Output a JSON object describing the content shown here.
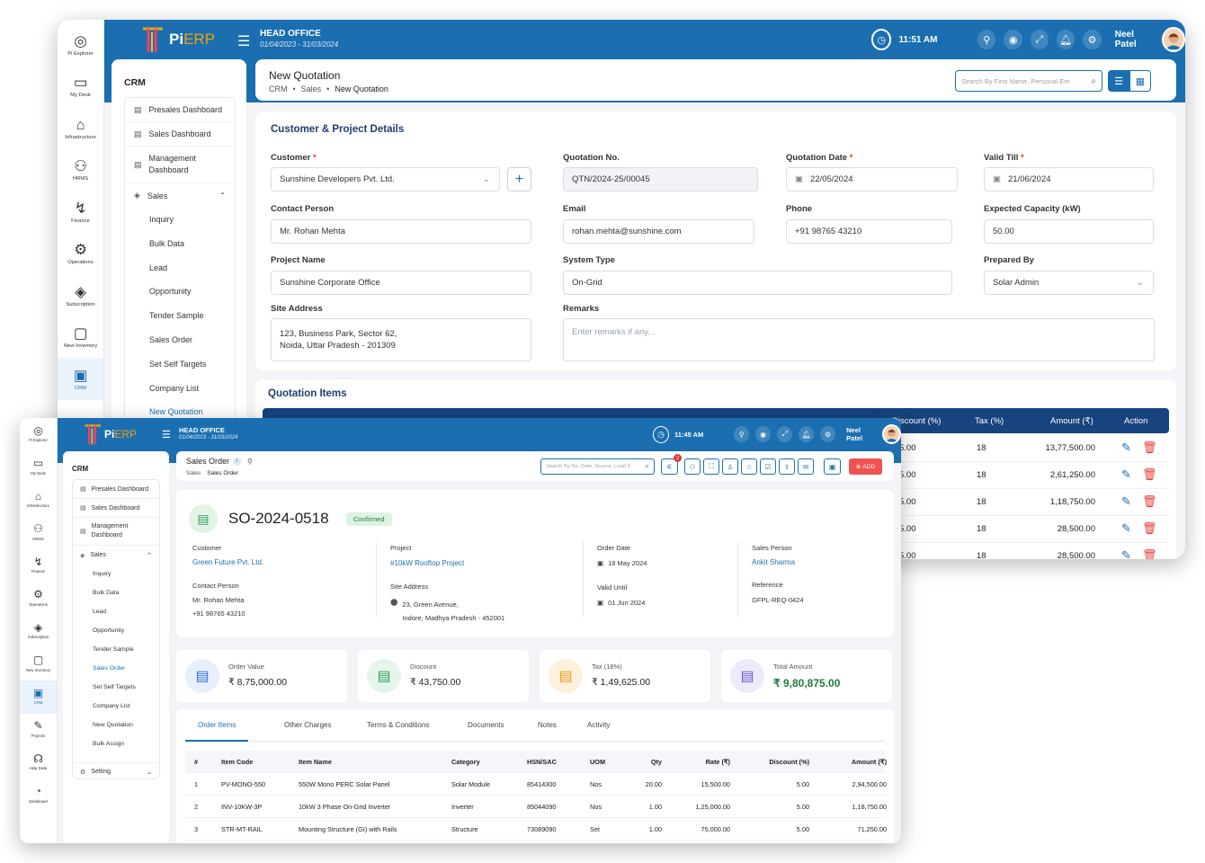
{
  "back": {
    "rail": [
      {
        "icon": "compass-icon",
        "label": "Pi Explorer"
      },
      {
        "icon": "desktop-icon",
        "label": "My Desk"
      },
      {
        "icon": "building-icon",
        "label": "Infrastructure"
      },
      {
        "icon": "people-icon",
        "label": "HRMS"
      },
      {
        "icon": "finance-icon",
        "label": "Finance"
      },
      {
        "icon": "operations-icon",
        "label": "Operations"
      },
      {
        "icon": "tag-icon",
        "label": "Subscription"
      },
      {
        "icon": "inventory-icon",
        "label": "New Inventory"
      },
      {
        "icon": "crm-icon",
        "label": "CRM"
      }
    ],
    "logo": {
      "pi": "Pi",
      "erp": "ERP"
    },
    "office": {
      "title": "HEAD OFFICE",
      "dates": "01/04/2023 - 31/03/2024"
    },
    "time": "11:51 AM",
    "user": "Neel Patel",
    "menu": {
      "title": "CRM",
      "items": [
        "Presales Dashboard",
        "Sales Dashboard",
        "Management Dashboard"
      ],
      "group": "Sales",
      "subs": [
        "Inquiry",
        "Bulk Data",
        "Lead",
        "Opportunity",
        "Tender Sample",
        "Sales Order",
        "Set Self Targets",
        "Company List",
        "New Quotation"
      ]
    },
    "page": {
      "title": "New Quotation",
      "crumbs": [
        "CRM",
        "Sales",
        "New Quotation"
      ],
      "search_placeholder": "Search By First Name, Personal Em"
    },
    "form": {
      "heading": "Customer & Project Details",
      "customer_label": "Customer",
      "customer": "Sunshine Developers Pvt. Ltd.",
      "qno_label": "Quotation No.",
      "qno": "QTN/2024-25/00045",
      "qdate_label": "Quotation Date",
      "qdate": "22/05/2024",
      "valid_label": "Valid Till",
      "valid": "21/06/2024",
      "contact_label": "Contact Person",
      "contact": "Mr. Rohan Mehta",
      "email_label": "Email",
      "email": "rohan.mehta@sunshine.com",
      "phone_label": "Phone",
      "phone": "+91 98765 43210",
      "cap_label": "Expected Capacity (kW)",
      "cap": "50.00",
      "project_label": "Project Name",
      "project": "Sunshine Corporate Office",
      "system_label": "System Type",
      "system": "On-Grid",
      "prep_label": "Prepared By",
      "prep": "Solar Admin",
      "site_label": "Site Address",
      "site1": "123, Business Park, Sector 62,",
      "site2": "Noida, Uttar Pradesh - 201309",
      "remarks_label": "Remarks",
      "remarks_placeholder": "Enter remarks if any..."
    },
    "items": {
      "heading": "Quotation Items",
      "cols": [
        "Discount (%)",
        "Tax (%)",
        "Amount (₹)",
        "Action"
      ],
      "rows": [
        [
          "5.00",
          "18",
          "13,77,500.00"
        ],
        [
          "5.00",
          "18",
          "2,61,250.00"
        ],
        [
          "5.00",
          "18",
          "1,18,750.00"
        ],
        [
          "5.00",
          "18",
          "28,500.00"
        ],
        [
          "5.00",
          "18",
          "28,500.00"
        ]
      ]
    }
  },
  "front": {
    "rail": [
      {
        "icon": "compass-icon",
        "label": "Pi Explorer"
      },
      {
        "icon": "desktop-icon",
        "label": "My Desk"
      },
      {
        "icon": "building-icon",
        "label": "Infrastructure"
      },
      {
        "icon": "people-icon",
        "label": "HRMS"
      },
      {
        "icon": "finance-icon",
        "label": "Finance"
      },
      {
        "icon": "operations-icon",
        "label": "Operations"
      },
      {
        "icon": "tag-icon",
        "label": "Subscription"
      },
      {
        "icon": "inventory-icon",
        "label": "New Inventory"
      },
      {
        "icon": "crm-icon",
        "label": "CRM"
      },
      {
        "icon": "projects-icon",
        "label": "Projects"
      },
      {
        "icon": "helpdesk-icon",
        "label": "Help Desk"
      },
      {
        "icon": "dashboard-icon",
        "label": "Dashboard"
      }
    ],
    "logo": {
      "pi": "Pi",
      "erp": "ERP"
    },
    "office": {
      "title": "HEAD OFFICE",
      "dates": "01/04/2023 - 31/03/2024"
    },
    "time": "11:45 AM",
    "user": "Neel Patel",
    "badge": "2",
    "menu": {
      "title": "CRM",
      "items": [
        "Presales Dashboard",
        "Sales Dashboard",
        "Management Dashboard"
      ],
      "group": "Sales",
      "subs": [
        "Inquiry",
        "Bulk Data",
        "Lead",
        "Opportunity",
        "Tender Sample",
        "Sales Order",
        "Set Self Targets",
        "Company List",
        "New Quotation",
        "Bulk Assign"
      ],
      "setting": "Setting"
    },
    "page": {
      "title": "Sales Order",
      "crumbs": [
        "Sales",
        "Sales Order"
      ],
      "search_placeholder": "Search By No, Date, Source, Lead S",
      "add": "ADD"
    },
    "order": {
      "number": "SO-2024-0518",
      "status": "Confirmed",
      "customer_label": "Customer",
      "customer": "Green Future Pvt. Ltd.",
      "contact_label": "Contact Person",
      "contact": "Mr. Rohan Mehta",
      "phone": "+91 98765 43210",
      "project_label": "Project",
      "project": "#10kW Rooftop Project",
      "site_label": "Site Address",
      "site1": "23, Green Avenue,",
      "site2": "Indore, Madhya Pradesh - 452001",
      "odate_label": "Order Date",
      "odate": "18 May 2024",
      "valid_label": "Valid Until",
      "valid": "01 Jun 2024",
      "sp_label": "Sales Person",
      "sp": "Ankit Sharma",
      "ref_label": "Reference",
      "ref": "GFPL-REQ-0424"
    },
    "stats": [
      {
        "label": "Order Value",
        "value": "₹ 8,75,000.00",
        "color": "#2f6fd6",
        "bg": "#e7effc"
      },
      {
        "label": "Discount",
        "value": "₹ 43,750.00",
        "color": "#2e9d57",
        "bg": "#e5f5ea"
      },
      {
        "label": "Tax (18%)",
        "value": "₹ 1,49,625.00",
        "color": "#f29b1d",
        "bg": "#fdf0dc"
      },
      {
        "label": "Total Amount",
        "value": "₹ 9,80,875.00",
        "color": "#6b55c9",
        "bg": "#eeeafb"
      }
    ],
    "tabs": [
      "Order Items",
      "Other Charges",
      "Terms & Conditions",
      "Documents",
      "Notes",
      "Activity"
    ],
    "table": {
      "cols": [
        "#",
        "Item Code",
        "Item Name",
        "Category",
        "HSN/SAC",
        "UOM",
        "Qty",
        "Rate (₹)",
        "Discount (%)",
        "Amount (₹)"
      ],
      "rows": [
        [
          "1",
          "PV-MONO-550",
          "550W Mono PERC Solar Panel",
          "Solar Module",
          "85414300",
          "Nos",
          "20.00",
          "15,500.00",
          "5.00",
          "2,94,500.00"
        ],
        [
          "2",
          "INV-10KW-3P",
          "10kW 3 Phase On-Grid Inverter",
          "Inverter",
          "85044090",
          "Nos",
          "1.00",
          "1,25,000.00",
          "5.00",
          "1,18,750.00"
        ],
        [
          "3",
          "STR-MT-RAIL",
          "Mounting Structure (GI) with Rails",
          "Structure",
          "73089090",
          "Set",
          "1.00",
          "75,000.00",
          "5.00",
          "71,250.00"
        ]
      ]
    }
  }
}
